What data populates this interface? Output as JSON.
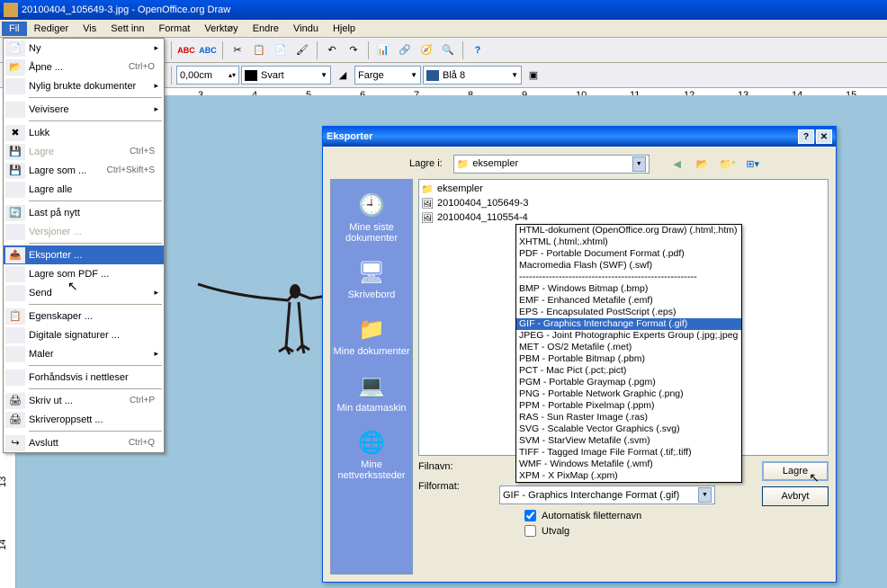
{
  "window": {
    "title": "20100404_105649-3.jpg - OpenOffice.org Draw"
  },
  "menubar": {
    "items": [
      "Fil",
      "Rediger",
      "Vis",
      "Sett inn",
      "Format",
      "Verktøy",
      "Endre",
      "Vindu",
      "Hjelp"
    ]
  },
  "toolbar2": {
    "size_value": "0,00cm",
    "color1": "Svart",
    "fill_type": "Farge",
    "color2": "Blå 8"
  },
  "ruler": {
    "ticks": [
      "3",
      "4",
      "5",
      "6",
      "7",
      "8",
      "9",
      "10",
      "11",
      "12",
      "13",
      "14",
      "15"
    ]
  },
  "left_ruler": {
    "ticks": [
      "13",
      "14"
    ]
  },
  "file_menu": {
    "ny": "Ny",
    "apne": "Åpne ...",
    "apne_short": "Ctrl+O",
    "nylig": "Nylig brukte dokumenter",
    "veivisere": "Veivisere",
    "lukk": "Lukk",
    "lagre": "Lagre",
    "lagre_short": "Ctrl+S",
    "lagre_som": "Lagre som ...",
    "lagre_som_short": "Ctrl+Skift+S",
    "lagre_alle": "Lagre alle",
    "last_ny": "Last på nytt",
    "versjoner": "Versjoner ...",
    "eksporter": "Eksporter ...",
    "lagre_pdf": "Lagre som PDF ...",
    "send": "Send",
    "egenskaper": "Egenskaper ...",
    "digitale": "Digitale signaturer ...",
    "maler": "Maler",
    "forhandsvis": "Forhåndsvis i nettleser",
    "skriv_ut": "Skriv ut ...",
    "skriv_ut_short": "Ctrl+P",
    "skriveroppsett": "Skriveroppsett ...",
    "avslutt": "Avslutt",
    "avslutt_short": "Ctrl+Q"
  },
  "export_dialog": {
    "title": "Eksporter",
    "lagre_i_label": "Lagre i:",
    "lagre_i_value": "eksempler",
    "folder_name": "eksempler",
    "files": [
      "20100404_105649-3",
      "20100404_110554-4"
    ],
    "places": {
      "recent": "Mine siste dokumenter",
      "desktop": "Skrivebord",
      "documents": "Mine dokumenter",
      "computer": "Min datamaskin",
      "network": "Mine nettverkssteder"
    },
    "formats": {
      "html": "HTML-dokument (OpenOffice.org Draw) (.html;.htm)",
      "xhtml": "XHTML (.html;.xhtml)",
      "pdf": "PDF - Portable Document Format (.pdf)",
      "swf": "Macromedia Flash (SWF) (.swf)",
      "sep": "------------------------------------------------------",
      "bmp": "BMP - Windows Bitmap (.bmp)",
      "emf": "EMF - Enhanced Metafile (.emf)",
      "eps": "EPS - Encapsulated PostScript (.eps)",
      "gif": "GIF - Graphics Interchange Format (.gif)",
      "jpeg": "JPEG - Joint Photographic Experts Group (.jpg;.jpeg",
      "met": "MET - OS/2 Metafile (.met)",
      "pbm": "PBM - Portable Bitmap (.pbm)",
      "pct": "PCT - Mac Pict (.pct;.pict)",
      "pgm": "PGM - Portable Graymap (.pgm)",
      "png": "PNG - Portable Network Graphic (.png)",
      "ppm": "PPM - Portable Pixelmap (.ppm)",
      "ras": "RAS - Sun Raster Image (.ras)",
      "svg": "SVG - Scalable Vector Graphics (.svg)",
      "svm": "SVM - StarView Metafile (.svm)",
      "tiff": "TIFF - Tagged Image File Format (.tif;.tiff)",
      "wmf": "WMF - Windows Metafile (.wmf)",
      "xpm": "XPM - X PixMap (.xpm)"
    },
    "filnavn_label": "Filnavn:",
    "filformat_label": "Filformat:",
    "filformat_value": "GIF - Graphics Interchange Format (.gif)",
    "lagre_btn": "Lagre",
    "avbryt_btn": "Avbryt",
    "auto_ext": "Automatisk filetternavn",
    "utvalg": "Utvalg"
  }
}
